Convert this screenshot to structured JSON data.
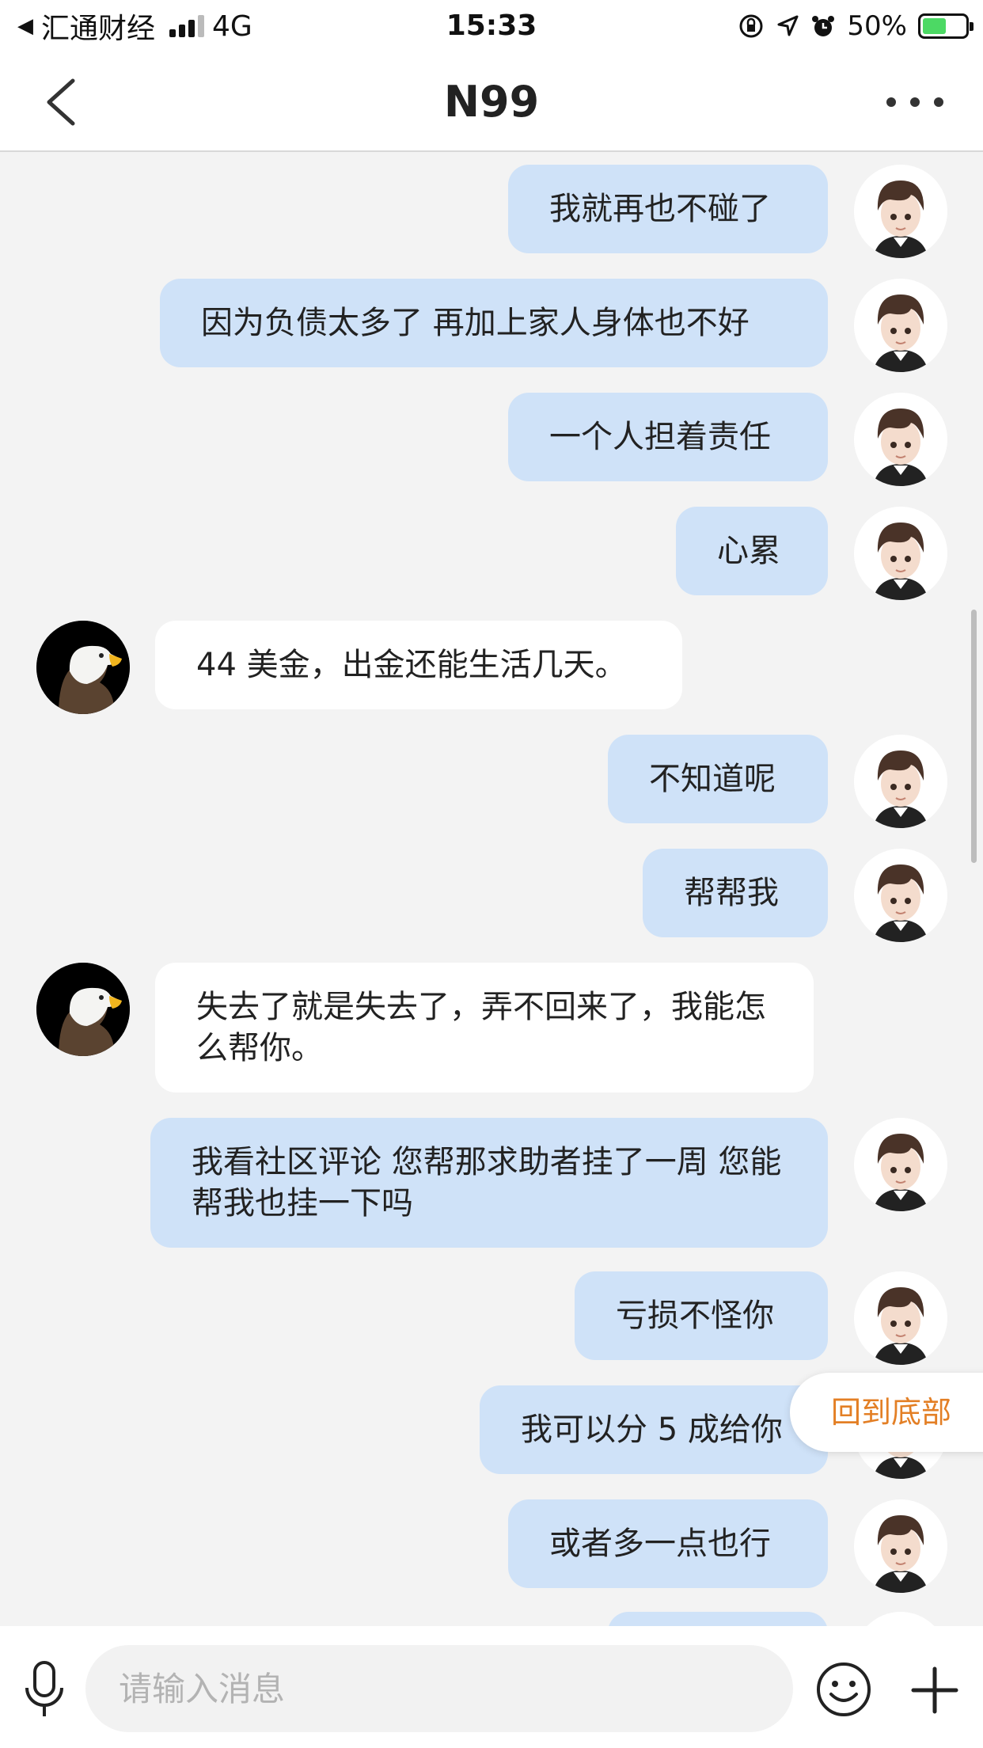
{
  "status_bar": {
    "app_back": "汇通财经",
    "network": "4G",
    "time": "15:33",
    "battery": "50%",
    "battery_level": 0.5
  },
  "nav": {
    "title": "N99"
  },
  "messages": [
    {
      "side": "me",
      "text": "我就再也不碰了"
    },
    {
      "side": "me",
      "text": "因为负债太多了 再加上家人身体也不好"
    },
    {
      "side": "me",
      "text": "一个人担着责任"
    },
    {
      "side": "me",
      "text": "心累"
    },
    {
      "side": "them",
      "text": "44 美金，出金还能生活几天。"
    },
    {
      "side": "me",
      "text": "不知道呢"
    },
    {
      "side": "me",
      "text": "帮帮我"
    },
    {
      "side": "them",
      "text": "失去了就是失去了，弄不回来了，我能怎么帮你。"
    },
    {
      "side": "me",
      "text": "我看社区评论 您帮那求助者挂了一周 您能帮我也挂一下吗"
    },
    {
      "side": "me",
      "text": "亏损不怪你"
    },
    {
      "side": "me",
      "text": "我可以分 5 成给你"
    },
    {
      "side": "me",
      "text": "或者多一点也行"
    }
  ],
  "back_to_bottom": "回到底部",
  "input": {
    "placeholder": "请输入消息"
  },
  "colors": {
    "my_bubble": "#cfe2f8",
    "their_bubble": "#ffffff",
    "accent_orange": "#e37f25"
  }
}
